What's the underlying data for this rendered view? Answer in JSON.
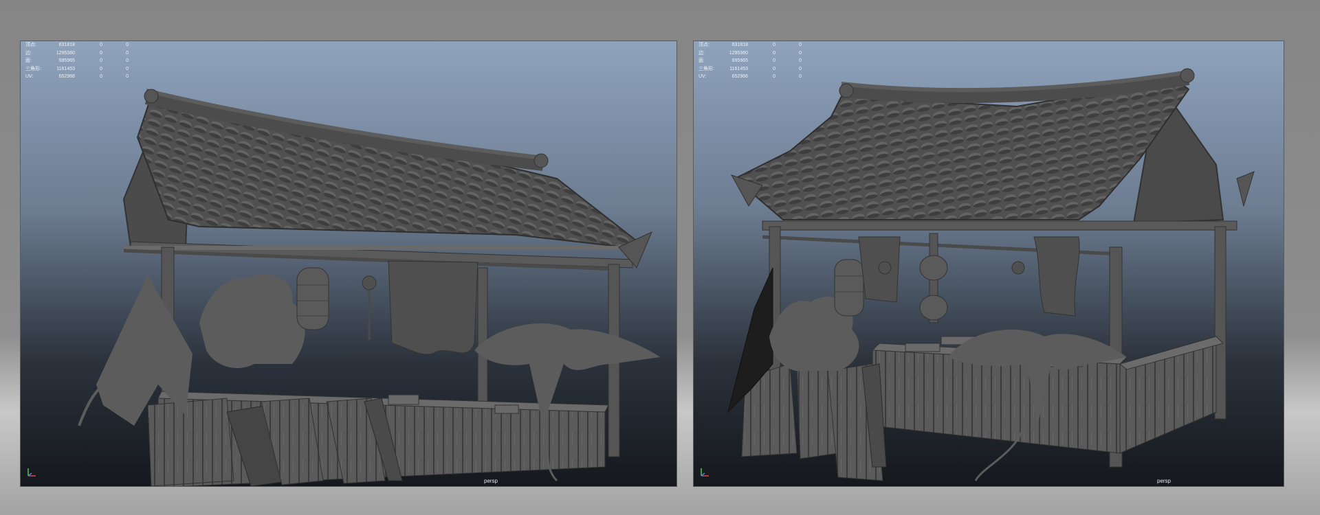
{
  "viewports": [
    {
      "hud": [
        {
          "label": "顶点:",
          "value": "631818",
          "a": "0",
          "b": "0"
        },
        {
          "label": "边:",
          "value": "1295360",
          "a": "0",
          "b": "0"
        },
        {
          "label": "面:",
          "value": "695965",
          "a": "0",
          "b": "0"
        },
        {
          "label": "三角形:",
          "value": "1161453",
          "a": "0",
          "b": "0"
        },
        {
          "label": "UV:",
          "value": "652966",
          "a": "0",
          "b": "0"
        }
      ],
      "camera": "persp"
    },
    {
      "hud": [
        {
          "label": "顶点:",
          "value": "631818",
          "a": "0",
          "b": "0"
        },
        {
          "label": "边:",
          "value": "1295360",
          "a": "0",
          "b": "0"
        },
        {
          "label": "面:",
          "value": "695965",
          "a": "0",
          "b": "0"
        },
        {
          "label": "三角形:",
          "value": "1161453",
          "a": "0",
          "b": "0"
        },
        {
          "label": "UV:",
          "value": "652966",
          "a": "0",
          "b": "0"
        }
      ],
      "camera": "persp"
    }
  ],
  "colors": {
    "gradient_top": "#8fa3bd",
    "gradient_bottom": "#15181d",
    "model_gray": "#5e5e5e",
    "axis_x": "#d84a4a",
    "axis_y": "#52c452",
    "axis_z": "#4f7fe0"
  }
}
